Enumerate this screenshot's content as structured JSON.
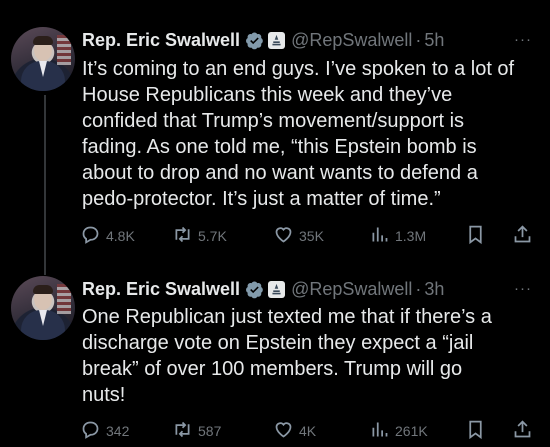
{
  "tweets": [
    {
      "author_name": "Rep. Eric Swalwell",
      "handle": "@RepSwalwell",
      "separator": "·",
      "time": "5h",
      "text_lines": [
        "It’s coming to an end guys. I’ve spoken to a lot of",
        "House Republicans this week and they’ve",
        "confided that Trump’s movement/support is",
        "fading. As one told me, “this Epstein bomb is",
        "about to drop and no want wants to defend a",
        "pedo-protector. It’s just a matter of time.”"
      ],
      "replies": "4.8K",
      "retweets": "5.7K",
      "likes": "35K",
      "views": "1.3M"
    },
    {
      "author_name": "Rep. Eric Swalwell",
      "handle": "@RepSwalwell",
      "separator": "·",
      "time": "3h",
      "text_lines": [
        "One Republican just texted me that if there’s a",
        "discharge vote on Epstein they expect a “jail",
        "break” of over 100 members.  Trump will go",
        "nuts!"
      ],
      "replies": "342",
      "retweets": "587",
      "likes": "4K",
      "views": "261K"
    }
  ],
  "icons": {
    "verified": "verified-badge-icon",
    "government": "government-badge-icon",
    "more": "more-icon",
    "reply": "reply-icon",
    "retweet": "retweet-icon",
    "like": "heart-icon",
    "views": "views-icon",
    "bookmark": "bookmark-icon",
    "share": "share-icon"
  },
  "more_glyph": "···",
  "colors": {
    "background": "#000000",
    "text": "#e7e9ea",
    "muted": "#71767b",
    "verified": "#829aab",
    "thread_line": "#333639"
  }
}
